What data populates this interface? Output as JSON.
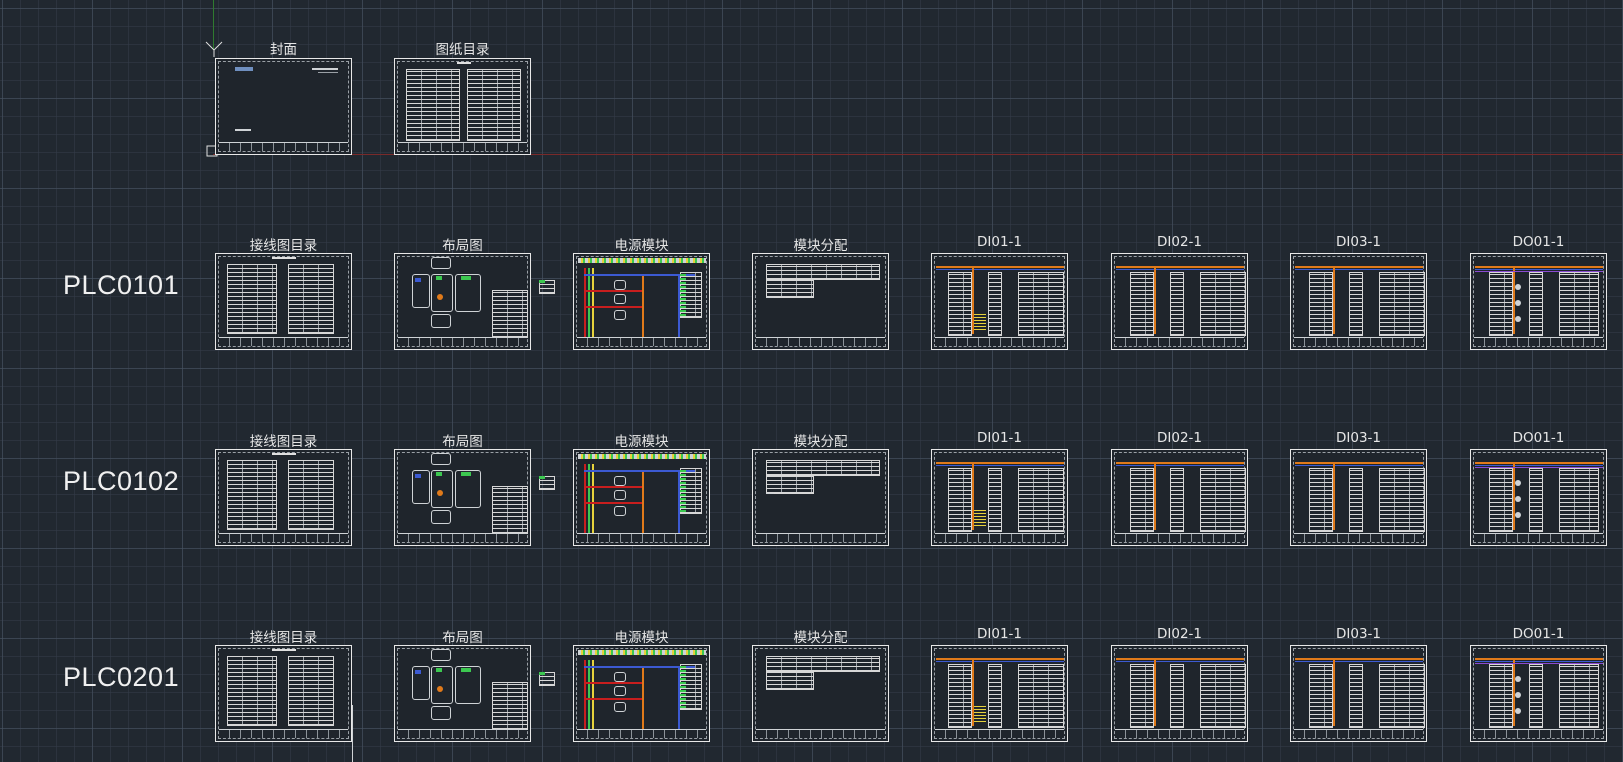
{
  "cover_row": {
    "sheets": [
      "封面",
      "图纸目录"
    ]
  },
  "rows": [
    {
      "name": "PLC0101",
      "sheets": [
        "接线图目录",
        "布局图",
        "电源模块",
        "模块分配",
        "DI01-1",
        "DI02-1",
        "DI03-1",
        "DO01-1"
      ]
    },
    {
      "name": "PLC0102",
      "sheets": [
        "接线图目录",
        "布局图",
        "电源模块",
        "模块分配",
        "DI01-1",
        "DI02-1",
        "DI03-1",
        "DO01-1"
      ]
    },
    {
      "name": "PLC0201",
      "sheets": [
        "接线图目录",
        "布局图",
        "电源模块",
        "模块分配",
        "DI01-1",
        "DI02-1",
        "DI03-1",
        "DO01-1"
      ]
    }
  ],
  "colors": {
    "background": "#212830",
    "sheet_border": "#e8e8e8",
    "red_wire": "#c81e1e",
    "orange_wire": "#e07a1a",
    "green_wire": "#3cc850",
    "blue_wire": "#3c5ad2",
    "yellow_wire": "#e6d23c",
    "x_axis": "#a83232",
    "y_axis": "#2f7a2f"
  }
}
